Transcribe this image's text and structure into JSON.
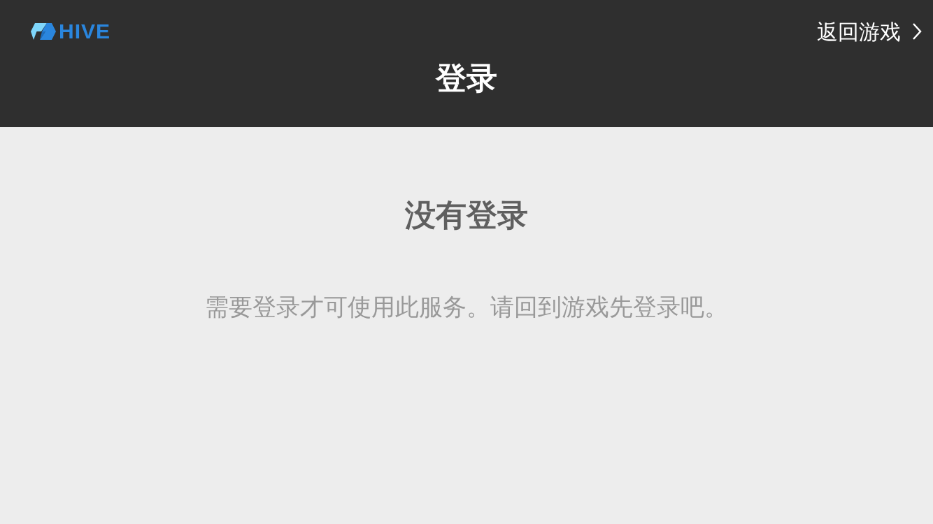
{
  "header": {
    "logo": "HIVE",
    "back_link": "返回游戏",
    "title": "登录"
  },
  "content": {
    "heading": "没有登录",
    "message": "需要登录才可使用此服务。请回到游戏先登录吧。"
  }
}
